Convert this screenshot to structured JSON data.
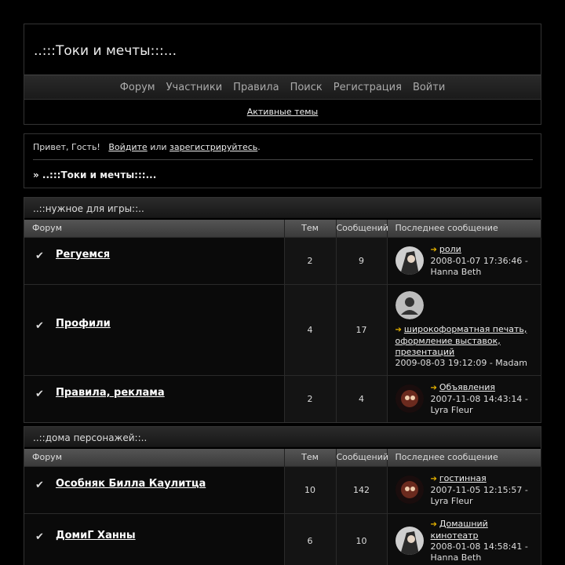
{
  "site": {
    "title": "..:::Токи и мечты:::..."
  },
  "nav": {
    "items": [
      "Форум",
      "Участники",
      "Правила",
      "Поиск",
      "Регистрация",
      "Войти"
    ],
    "active_topics": "Активные темы"
  },
  "welcome": {
    "greeting": "Привет, Гость!",
    "login": "Войдите",
    "or": "или",
    "register": "зарегистрируйтесь",
    "dot": "."
  },
  "breadcrumb": "» ..:::Токи и мечты:::...",
  "columns": {
    "forum": "Форум",
    "topics": "Тем",
    "posts": "Сообщений",
    "last": "Последнее сообщение"
  },
  "categories": [
    {
      "title": "..::нужное для игры::..",
      "forums": [
        {
          "name": "Регуемся",
          "topics": "2",
          "posts": "9",
          "last_topic": "роли",
          "last_info": "2008-01-07 17:36:46 - Hanna Beth"
        },
        {
          "name": "Профили",
          "topics": "4",
          "posts": "17",
          "last_topic": "широкоформатная печать, оформление выставок, презентаций",
          "last_info": "2009-08-03 19:12:09 - Madam"
        },
        {
          "name": "Правила, реклама",
          "topics": "2",
          "posts": "4",
          "last_topic": "Объявления",
          "last_info": "2007-11-08 14:43:14 - Lyra Fleur"
        }
      ]
    },
    {
      "title": "..::дома персонажей::..",
      "forums": [
        {
          "name": "Особняк Билла Каулитца",
          "topics": "10",
          "posts": "142",
          "last_topic": "гостинная",
          "last_info": "2007-11-05 12:15:57 - Lyra Fleur"
        },
        {
          "name": "ДомиГ Ханны",
          "topics": "6",
          "posts": "10",
          "last_topic": "Домашний кинотеатр",
          "last_info": "2008-01-08 14:58:41 - Hanna Beth"
        }
      ]
    }
  ]
}
